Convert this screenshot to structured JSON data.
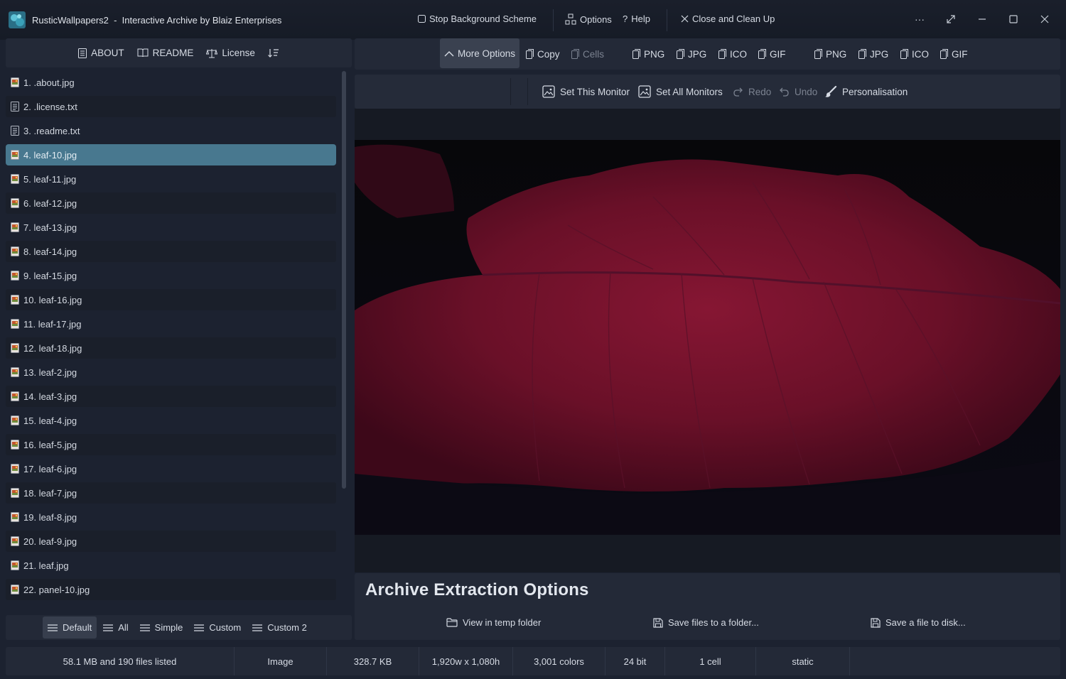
{
  "window": {
    "title": "RusticWallpapers2  -  Interactive Archive by Blaiz Enterprises",
    "stop_bg": "Stop Background Scheme",
    "options": "Options",
    "help": "Help",
    "close_clean": "Close and Clean Up",
    "more_icon": "ellipsis-icon"
  },
  "left_toolbar": {
    "about": "ABOUT",
    "readme": "README",
    "license": "License",
    "sort_icon": "sort-icon"
  },
  "files": [
    {
      "label": "1. .about.jpg",
      "type": "image"
    },
    {
      "label": "2. .license.txt",
      "type": "text"
    },
    {
      "label": "3. .readme.txt",
      "type": "text"
    },
    {
      "label": "4. leaf-10.jpg",
      "type": "image",
      "selected": true
    },
    {
      "label": "5. leaf-11.jpg",
      "type": "image"
    },
    {
      "label": "6. leaf-12.jpg",
      "type": "image"
    },
    {
      "label": "7. leaf-13.jpg",
      "type": "image"
    },
    {
      "label": "8. leaf-14.jpg",
      "type": "image"
    },
    {
      "label": "9. leaf-15.jpg",
      "type": "image"
    },
    {
      "label": "10. leaf-16.jpg",
      "type": "image"
    },
    {
      "label": "11. leaf-17.jpg",
      "type": "image"
    },
    {
      "label": "12. leaf-18.jpg",
      "type": "image"
    },
    {
      "label": "13. leaf-2.jpg",
      "type": "image"
    },
    {
      "label": "14. leaf-3.jpg",
      "type": "image"
    },
    {
      "label": "15. leaf-4.jpg",
      "type": "image"
    },
    {
      "label": "16. leaf-5.jpg",
      "type": "image"
    },
    {
      "label": "17. leaf-6.jpg",
      "type": "image"
    },
    {
      "label": "18. leaf-7.jpg",
      "type": "image"
    },
    {
      "label": "19. leaf-8.jpg",
      "type": "image"
    },
    {
      "label": "20. leaf-9.jpg",
      "type": "image"
    },
    {
      "label": "21. leaf.jpg",
      "type": "image"
    },
    {
      "label": "22. panel-10.jpg",
      "type": "image"
    }
  ],
  "view_bar": {
    "default": "Default",
    "all": "All",
    "simple": "Simple",
    "custom": "Custom",
    "custom2": "Custom 2"
  },
  "right_toolbar": {
    "more_options": "More Options",
    "copy": "Copy",
    "cells": "Cells",
    "fmt_a": [
      "PNG",
      "JPG",
      "ICO",
      "GIF"
    ],
    "fmt_b": [
      "PNG",
      "JPG",
      "ICO",
      "GIF"
    ]
  },
  "sub_toolbar": {
    "set_this": "Set This Monitor",
    "set_all": "Set All Monitors",
    "redo": "Redo",
    "undo": "Undo",
    "personalisation": "Personalisation"
  },
  "extraction": {
    "title": "Archive Extraction Options",
    "view_temp": "View in temp folder",
    "save_folder": "Save files to a folder...",
    "save_file": "Save a file to disk..."
  },
  "status": {
    "summary": "58.1 MB and 190 files listed",
    "kind": "Image",
    "size": "328.7 KB",
    "dims": "1,920w x 1,080h",
    "colors": "3,001 colors",
    "bits": "24 bit",
    "cells": "1 cell",
    "anim": "static"
  },
  "colors": {
    "accent_selected": "#48788f",
    "leaf": "#7a1430",
    "background": "#1c2230"
  }
}
